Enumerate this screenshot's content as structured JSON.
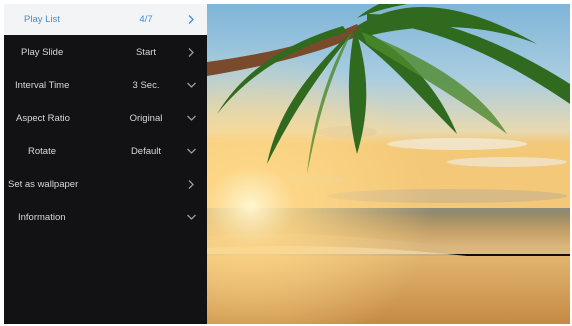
{
  "menu": {
    "items": [
      {
        "label": "Play List",
        "value": "4/7",
        "control": "chevron-right-icon",
        "active": true
      },
      {
        "label": "Play Slide",
        "value": "Start",
        "control": "chevron-right-icon",
        "active": false
      },
      {
        "label": "Interval Time",
        "value": "3 Sec.",
        "control": "chevron-down-icon",
        "active": false
      },
      {
        "label": "Aspect Ratio",
        "value": "Original",
        "control": "chevron-down-icon",
        "active": false
      },
      {
        "label": "Rotate",
        "value": "Default",
        "control": "chevron-down-icon",
        "active": false
      },
      {
        "label": "Set as wallpaper",
        "value": "",
        "control": "chevron-right-icon",
        "active": false
      },
      {
        "label": "Information",
        "value": "",
        "control": "chevron-down-icon",
        "active": false
      }
    ]
  },
  "colors": {
    "panel_bg": "#121214",
    "active_bg": "#f2f4f6",
    "active_text": "#3d8fd9",
    "text": "#d8d8d8"
  }
}
